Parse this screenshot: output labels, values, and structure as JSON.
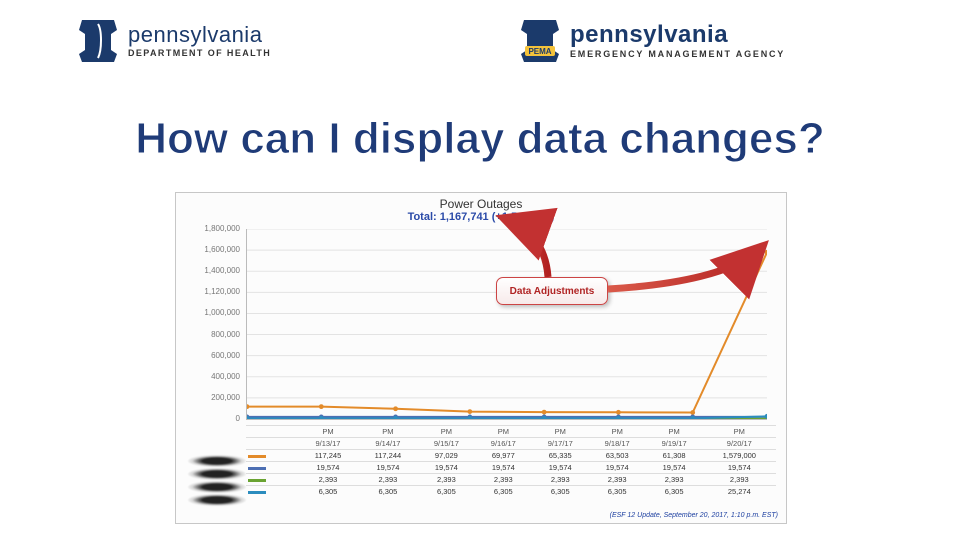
{
  "header": {
    "left_agency": {
      "name": "pennsylvania",
      "sub": "DEPARTMENT OF HEALTH"
    },
    "right_agency": {
      "name": "pennsylvania",
      "sub": "EMERGENCY MANAGEMENT AGENCY",
      "badge": "PEMA"
    }
  },
  "title": "How can I display data changes?",
  "chart": {
    "title": "Power Outages",
    "subtitle": "Total: 1,167,741 (+1,527,061)",
    "callout": "Data Adjustments",
    "footer": "(ESF 12 Update, September 20, 2017, 1:10 p.m. EST)"
  },
  "chart_data": {
    "type": "line",
    "xlabel": "",
    "ylabel": "",
    "ylim": [
      0,
      1800000
    ],
    "yticks": [
      "0",
      "200,000",
      "400,000",
      "600,000",
      "800,000",
      "1,000,000",
      "1,120,000",
      "1,400,000",
      "1,600,000",
      "1,800,000"
    ],
    "categories": [
      "9/13/17",
      "9/14/17",
      "9/15/17",
      "9/16/17",
      "9/17/17",
      "9/18/17",
      "9/19/17",
      "9/20/17"
    ],
    "category_header": "PM",
    "series": [
      {
        "name": "series1",
        "color": "#e38b2a",
        "values": [
          117245,
          117244,
          97029,
          69977,
          65335,
          63503,
          61308,
          1579000
        ],
        "labels": [
          "117,245",
          "117,244",
          "97,029",
          "69,977",
          "65,335",
          "63,503",
          "61,308",
          "1,579,000"
        ]
      },
      {
        "name": "series2",
        "color": "#4d6fb3",
        "values": [
          19574,
          19574,
          19574,
          19574,
          19574,
          19574,
          19574,
          19574
        ],
        "labels": [
          "19,574",
          "19,574",
          "19,574",
          "19,574",
          "19,574",
          "19,574",
          "19,574",
          "19,574"
        ]
      },
      {
        "name": "series3",
        "color": "#6aa332",
        "values": [
          2393,
          2393,
          2393,
          2393,
          2393,
          2393,
          2393,
          2393
        ],
        "labels": [
          "2,393",
          "2,393",
          "2,393",
          "2,393",
          "2,393",
          "2,393",
          "2,393",
          "2,393"
        ]
      },
      {
        "name": "series4",
        "color": "#2b8cbe",
        "values": [
          6305,
          6305,
          6305,
          6305,
          6305,
          6305,
          6305,
          25274
        ],
        "labels": [
          "6,305",
          "6,305",
          "6,305",
          "6,305",
          "6,305",
          "6,305",
          "6,305",
          "25,274"
        ]
      }
    ]
  }
}
